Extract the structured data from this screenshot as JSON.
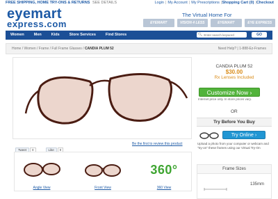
{
  "topbar": {
    "promo": "FREE SHIPPING, HOME TRY-ONS & RETURNS",
    "promo_link": "SEE DETAILS",
    "login": "Login",
    "account": "My Account",
    "prescriptions": "My Prescriptions",
    "cart": "Shopping Cart (0)",
    "checkout": "Checkout"
  },
  "logo": {
    "line1": "eyemart",
    "line2": "express.com"
  },
  "tagline": "The Virtual Home For",
  "brands": [
    "EYEMART",
    "VISION 4 LESS",
    "EYEMART",
    "EYE EXPRESS"
  ],
  "nav": {
    "items": [
      "Women",
      "Men",
      "Kids",
      "Store Services",
      "Find Stores"
    ],
    "search_placeholder": "Enter search keyword",
    "go_label": "GO"
  },
  "breadcrumb": {
    "path": "Home / Women / Frame / Full Frame Glasses / ",
    "current": "CANDIA PLUM 52",
    "help": "Need Help? | 1-888-Ez-Frames"
  },
  "social": {
    "tweet": "Tweet",
    "tweet_count": "0",
    "like": "Like",
    "like_count": "0"
  },
  "review_link": "Be the first to review this product",
  "views": {
    "angle": "Angle View",
    "front": "Front View",
    "v360_logo": "360°",
    "v360": "360 View"
  },
  "product": {
    "name": "CANDIA PLUM 52",
    "price": "$30.00",
    "rx": "Rx Lenses Included",
    "customize_label": "Customize Now ›",
    "price_note": "Internet price only. In store prices vary."
  },
  "or_label": "OR",
  "try": {
    "heading": "Try Before You Buy",
    "button": "Try Online ›",
    "text": "Upload a photo from your computer or webcam and \"try-on\" these frames using our Virtual Try-On"
  },
  "frame_sizes": {
    "heading": "Frame Sizes",
    "width": "135mm"
  },
  "colors": {
    "brand_blue": "#1d5aa6",
    "nav_blue": "#1c4f96",
    "green": "#52b33b",
    "orange": "#d98c19",
    "try_blue": "#2196d3",
    "frame_brown": "#5a2418"
  }
}
